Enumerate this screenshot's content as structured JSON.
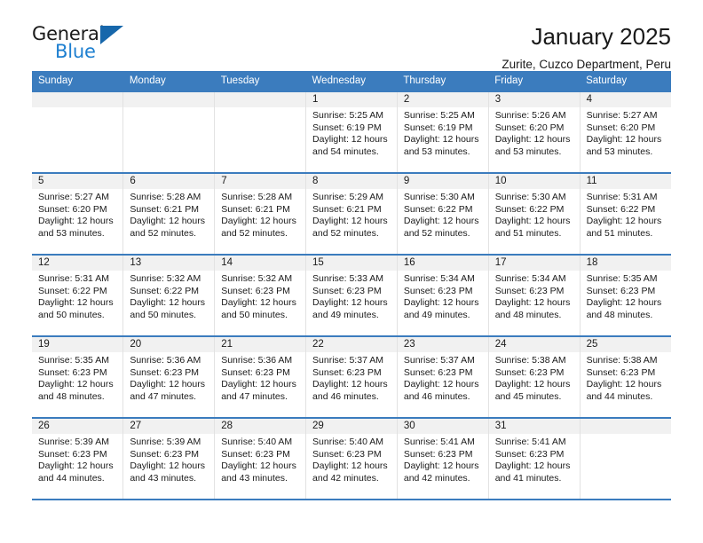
{
  "brand": {
    "name_top": "General",
    "name_bottom": "Blue",
    "accent_color": "#1d7fd0",
    "triangle_color": "#1767ab"
  },
  "header": {
    "title": "January 2025",
    "subtitle": "Zurite, Cuzco Department, Peru"
  },
  "theme": {
    "header_row_color": "#3b7cbe",
    "daynum_band_color": "#f1f1f1",
    "text_color": "#1a1a1a"
  },
  "weekday_headers": [
    "Sunday",
    "Monday",
    "Tuesday",
    "Wednesday",
    "Thursday",
    "Friday",
    "Saturday"
  ],
  "weeks": [
    [
      {
        "day": "",
        "empty": true
      },
      {
        "day": "",
        "empty": true
      },
      {
        "day": "",
        "empty": true
      },
      {
        "day": "1",
        "sunrise": "Sunrise: 5:25 AM",
        "sunset": "Sunset: 6:19 PM",
        "daylight_1": "Daylight: 12 hours",
        "daylight_2": "and 54 minutes."
      },
      {
        "day": "2",
        "sunrise": "Sunrise: 5:25 AM",
        "sunset": "Sunset: 6:19 PM",
        "daylight_1": "Daylight: 12 hours",
        "daylight_2": "and 53 minutes."
      },
      {
        "day": "3",
        "sunrise": "Sunrise: 5:26 AM",
        "sunset": "Sunset: 6:20 PM",
        "daylight_1": "Daylight: 12 hours",
        "daylight_2": "and 53 minutes."
      },
      {
        "day": "4",
        "sunrise": "Sunrise: 5:27 AM",
        "sunset": "Sunset: 6:20 PM",
        "daylight_1": "Daylight: 12 hours",
        "daylight_2": "and 53 minutes."
      }
    ],
    [
      {
        "day": "5",
        "sunrise": "Sunrise: 5:27 AM",
        "sunset": "Sunset: 6:20 PM",
        "daylight_1": "Daylight: 12 hours",
        "daylight_2": "and 53 minutes."
      },
      {
        "day": "6",
        "sunrise": "Sunrise: 5:28 AM",
        "sunset": "Sunset: 6:21 PM",
        "daylight_1": "Daylight: 12 hours",
        "daylight_2": "and 52 minutes."
      },
      {
        "day": "7",
        "sunrise": "Sunrise: 5:28 AM",
        "sunset": "Sunset: 6:21 PM",
        "daylight_1": "Daylight: 12 hours",
        "daylight_2": "and 52 minutes."
      },
      {
        "day": "8",
        "sunrise": "Sunrise: 5:29 AM",
        "sunset": "Sunset: 6:21 PM",
        "daylight_1": "Daylight: 12 hours",
        "daylight_2": "and 52 minutes."
      },
      {
        "day": "9",
        "sunrise": "Sunrise: 5:30 AM",
        "sunset": "Sunset: 6:22 PM",
        "daylight_1": "Daylight: 12 hours",
        "daylight_2": "and 52 minutes."
      },
      {
        "day": "10",
        "sunrise": "Sunrise: 5:30 AM",
        "sunset": "Sunset: 6:22 PM",
        "daylight_1": "Daylight: 12 hours",
        "daylight_2": "and 51 minutes."
      },
      {
        "day": "11",
        "sunrise": "Sunrise: 5:31 AM",
        "sunset": "Sunset: 6:22 PM",
        "daylight_1": "Daylight: 12 hours",
        "daylight_2": "and 51 minutes."
      }
    ],
    [
      {
        "day": "12",
        "sunrise": "Sunrise: 5:31 AM",
        "sunset": "Sunset: 6:22 PM",
        "daylight_1": "Daylight: 12 hours",
        "daylight_2": "and 50 minutes."
      },
      {
        "day": "13",
        "sunrise": "Sunrise: 5:32 AM",
        "sunset": "Sunset: 6:22 PM",
        "daylight_1": "Daylight: 12 hours",
        "daylight_2": "and 50 minutes."
      },
      {
        "day": "14",
        "sunrise": "Sunrise: 5:32 AM",
        "sunset": "Sunset: 6:23 PM",
        "daylight_1": "Daylight: 12 hours",
        "daylight_2": "and 50 minutes."
      },
      {
        "day": "15",
        "sunrise": "Sunrise: 5:33 AM",
        "sunset": "Sunset: 6:23 PM",
        "daylight_1": "Daylight: 12 hours",
        "daylight_2": "and 49 minutes."
      },
      {
        "day": "16",
        "sunrise": "Sunrise: 5:34 AM",
        "sunset": "Sunset: 6:23 PM",
        "daylight_1": "Daylight: 12 hours",
        "daylight_2": "and 49 minutes."
      },
      {
        "day": "17",
        "sunrise": "Sunrise: 5:34 AM",
        "sunset": "Sunset: 6:23 PM",
        "daylight_1": "Daylight: 12 hours",
        "daylight_2": "and 48 minutes."
      },
      {
        "day": "18",
        "sunrise": "Sunrise: 5:35 AM",
        "sunset": "Sunset: 6:23 PM",
        "daylight_1": "Daylight: 12 hours",
        "daylight_2": "and 48 minutes."
      }
    ],
    [
      {
        "day": "19",
        "sunrise": "Sunrise: 5:35 AM",
        "sunset": "Sunset: 6:23 PM",
        "daylight_1": "Daylight: 12 hours",
        "daylight_2": "and 48 minutes."
      },
      {
        "day": "20",
        "sunrise": "Sunrise: 5:36 AM",
        "sunset": "Sunset: 6:23 PM",
        "daylight_1": "Daylight: 12 hours",
        "daylight_2": "and 47 minutes."
      },
      {
        "day": "21",
        "sunrise": "Sunrise: 5:36 AM",
        "sunset": "Sunset: 6:23 PM",
        "daylight_1": "Daylight: 12 hours",
        "daylight_2": "and 47 minutes."
      },
      {
        "day": "22",
        "sunrise": "Sunrise: 5:37 AM",
        "sunset": "Sunset: 6:23 PM",
        "daylight_1": "Daylight: 12 hours",
        "daylight_2": "and 46 minutes."
      },
      {
        "day": "23",
        "sunrise": "Sunrise: 5:37 AM",
        "sunset": "Sunset: 6:23 PM",
        "daylight_1": "Daylight: 12 hours",
        "daylight_2": "and 46 minutes."
      },
      {
        "day": "24",
        "sunrise": "Sunrise: 5:38 AM",
        "sunset": "Sunset: 6:23 PM",
        "daylight_1": "Daylight: 12 hours",
        "daylight_2": "and 45 minutes."
      },
      {
        "day": "25",
        "sunrise": "Sunrise: 5:38 AM",
        "sunset": "Sunset: 6:23 PM",
        "daylight_1": "Daylight: 12 hours",
        "daylight_2": "and 44 minutes."
      }
    ],
    [
      {
        "day": "26",
        "sunrise": "Sunrise: 5:39 AM",
        "sunset": "Sunset: 6:23 PM",
        "daylight_1": "Daylight: 12 hours",
        "daylight_2": "and 44 minutes."
      },
      {
        "day": "27",
        "sunrise": "Sunrise: 5:39 AM",
        "sunset": "Sunset: 6:23 PM",
        "daylight_1": "Daylight: 12 hours",
        "daylight_2": "and 43 minutes."
      },
      {
        "day": "28",
        "sunrise": "Sunrise: 5:40 AM",
        "sunset": "Sunset: 6:23 PM",
        "daylight_1": "Daylight: 12 hours",
        "daylight_2": "and 43 minutes."
      },
      {
        "day": "29",
        "sunrise": "Sunrise: 5:40 AM",
        "sunset": "Sunset: 6:23 PM",
        "daylight_1": "Daylight: 12 hours",
        "daylight_2": "and 42 minutes."
      },
      {
        "day": "30",
        "sunrise": "Sunrise: 5:41 AM",
        "sunset": "Sunset: 6:23 PM",
        "daylight_1": "Daylight: 12 hours",
        "daylight_2": "and 42 minutes."
      },
      {
        "day": "31",
        "sunrise": "Sunrise: 5:41 AM",
        "sunset": "Sunset: 6:23 PM",
        "daylight_1": "Daylight: 12 hours",
        "daylight_2": "and 41 minutes."
      },
      {
        "day": "",
        "empty": true
      }
    ]
  ]
}
